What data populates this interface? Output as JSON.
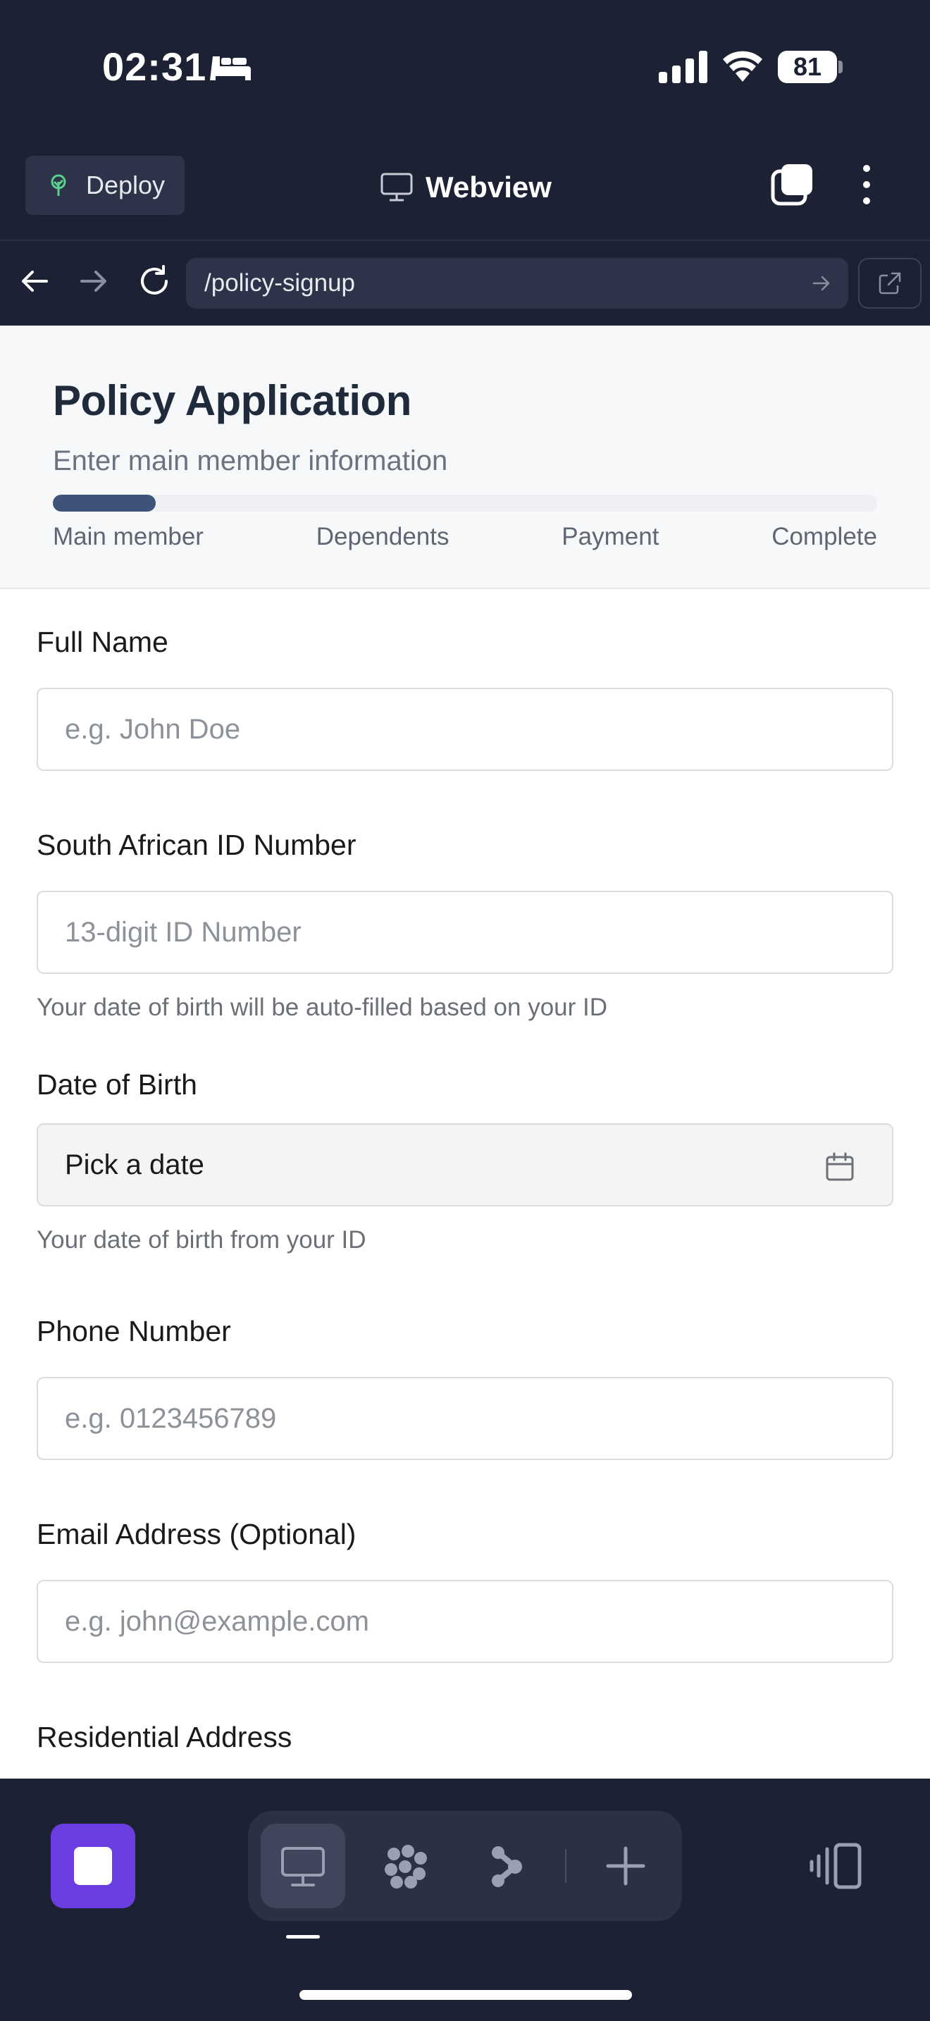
{
  "status_bar": {
    "time": "02:31",
    "battery": "81"
  },
  "header": {
    "deploy_label": "Deploy",
    "title": "Webview"
  },
  "url_bar": {
    "path": "/policy-signup"
  },
  "page": {
    "title": "Policy Application",
    "subtitle": "Enter main member information",
    "progress": 0.125,
    "steps": [
      "Main member",
      "Dependents",
      "Payment",
      "Complete"
    ]
  },
  "form": {
    "full_name": {
      "label": "Full Name",
      "placeholder": "e.g. John Doe"
    },
    "id_number": {
      "label": "South African ID Number",
      "placeholder": "13-digit ID Number",
      "help": "Your date of birth will be auto-filled based on your ID"
    },
    "dob": {
      "label": "Date of Birth",
      "value": "Pick a date",
      "help": "Your date of birth from your ID"
    },
    "phone": {
      "label": "Phone Number",
      "placeholder": "e.g. 0123456789"
    },
    "email": {
      "label": "Email Address (Optional)",
      "placeholder": "e.g. john@example.com"
    },
    "address": {
      "label": "Residential Address"
    }
  },
  "colors": {
    "accent": "#6a3ee0",
    "progress": "#3f5279",
    "chrome": "#1c2133"
  },
  "icons": [
    "bed-icon",
    "signal-icon",
    "wifi-icon",
    "tree-icon",
    "monitor-icon",
    "tabs-icon",
    "more-icon",
    "back-icon",
    "forward-icon",
    "reload-icon",
    "open-external-icon",
    "calendar-icon",
    "stop-icon",
    "agents-icon",
    "flow-icon",
    "plus-icon",
    "panel-icon"
  ]
}
